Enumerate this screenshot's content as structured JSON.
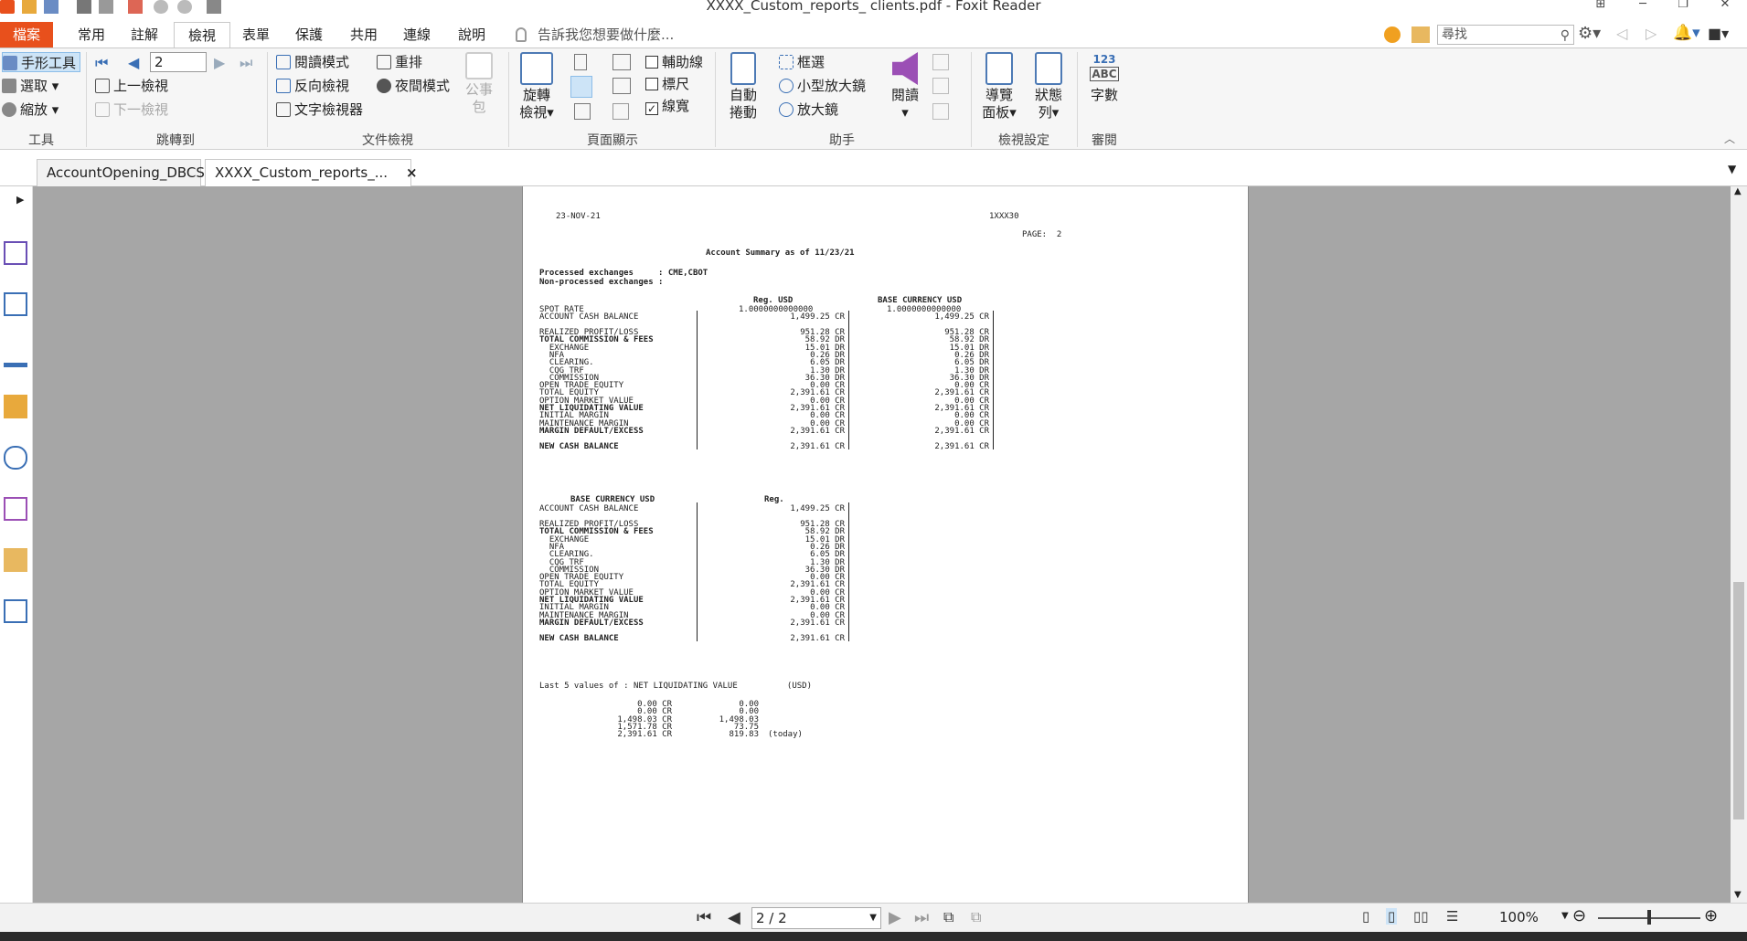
{
  "window": {
    "title": "XXXX_Custom_reports_ clients.pdf - Foxit Reader"
  },
  "tabs": [
    {
      "label": "檔案"
    },
    {
      "label": "常用"
    },
    {
      "label": "註解"
    },
    {
      "label": "檢視"
    },
    {
      "label": "表單"
    },
    {
      "label": "保護"
    },
    {
      "label": "共用"
    },
    {
      "label": "連線"
    },
    {
      "label": "說明"
    }
  ],
  "tell_me": "告訴我您想要做什麼...",
  "search": {
    "placeholder": "尋找"
  },
  "ribbon": {
    "tools": {
      "hand": "手形工具",
      "select": "選取",
      "zoom": "縮放",
      "label": "工具"
    },
    "goto": {
      "page": "2",
      "prev_view": "上一檢視",
      "next_view": "下一檢視",
      "label": "跳轉到"
    },
    "docview": {
      "read_mode": "閱讀模式",
      "reverse_view": "反向檢視",
      "text_viewer": "文字檢視器",
      "reflow": "重排",
      "night_mode": "夜間模式",
      "bulletin": "公事包",
      "label": "文件檢視"
    },
    "pagedisplay": {
      "rotate": "旋轉",
      "rotate2": "檢視",
      "guides": "輔助線",
      "ruler": "標尺",
      "linewidth": "線寬",
      "label": "頁面顯示"
    },
    "assistant": {
      "auto_scroll": "自動",
      "auto_scroll2": "捲動",
      "marquee": "框選",
      "loupe": "小型放大鏡",
      "magnifier": "放大鏡",
      "label": "助手"
    },
    "read": {
      "read": "閱讀"
    },
    "viewsettings": {
      "nav_panel": "導覽",
      "nav_panel2": "面板",
      "status_bar": "狀態",
      "status_bar2": "列",
      "label": "檢視設定"
    },
    "review": {
      "word_count": "字數",
      "icon_text_top": "123",
      "icon_text_bottom": "ABC",
      "label": "審閱"
    }
  },
  "doc_tabs": [
    {
      "label": "AccountOpening_DBCS..."
    },
    {
      "label": "XXXX_Custom_reports_...",
      "close": "×"
    }
  ],
  "pdf": {
    "date": "23-NOV-21",
    "acct": "1XXX30",
    "page_no": "PAGE:  2",
    "title": "Account Summary as of 11/23/21",
    "processed": "Processed exchanges     : CME,CBOT",
    "nonprocessed": "Non-processed exchanges :",
    "col1": "Reg. USD",
    "col2": "BASE CURRENCY USD",
    "spot_label": "SPOT RATE",
    "spot1": "1.0000000000000",
    "spot2": "1.0000000000000",
    "rows": [
      {
        "label": "ACCOUNT CASH BALANCE",
        "v1": "1,499.25 CR",
        "v2": "1,499.25 CR",
        "bold": false,
        "gap": false
      },
      {
        "label": "REALIZED PROFIT/LOSS",
        "v1": "951.28 CR",
        "v2": "951.28 CR",
        "bold": false,
        "gap": true
      },
      {
        "label": "TOTAL COMMISSION & FEES",
        "v1": "58.92 DR",
        "v2": "58.92 DR",
        "bold": true,
        "gap": false
      },
      {
        "label": "  EXCHANGE",
        "v1": "15.01 DR",
        "v2": "15.01 DR",
        "bold": false,
        "gap": false
      },
      {
        "label": "  NFA",
        "v1": "0.26 DR",
        "v2": "0.26 DR",
        "bold": false,
        "gap": false
      },
      {
        "label": "  CLEARING.",
        "v1": "6.05 DR",
        "v2": "6.05 DR",
        "bold": false,
        "gap": false
      },
      {
        "label": "  CQG TRF",
        "v1": "1.30 DR",
        "v2": "1.30 DR",
        "bold": false,
        "gap": false
      },
      {
        "label": "  COMMISSION",
        "v1": "36.30 DR",
        "v2": "36.30 DR",
        "bold": false,
        "gap": false
      },
      {
        "label": "OPEN TRADE EQUITY",
        "v1": "0.00 CR",
        "v2": "0.00 CR",
        "bold": false,
        "gap": false
      },
      {
        "label": "TOTAL EQUITY",
        "v1": "2,391.61 CR",
        "v2": "2,391.61 CR",
        "bold": false,
        "gap": false
      },
      {
        "label": "OPTION MARKET VALUE",
        "v1": "0.00 CR",
        "v2": "0.00 CR",
        "bold": false,
        "gap": false
      },
      {
        "label": "NET LIQUIDATING VALUE",
        "v1": "2,391.61 CR",
        "v2": "2,391.61 CR",
        "bold": true,
        "gap": false
      },
      {
        "label": "INITIAL MARGIN",
        "v1": "0.00 CR",
        "v2": "0.00 CR",
        "bold": false,
        "gap": false
      },
      {
        "label": "MAINTENANCE MARGIN",
        "v1": "0.00 CR",
        "v2": "0.00 CR",
        "bold": false,
        "gap": false
      },
      {
        "label": "MARGIN DEFAULT/EXCESS",
        "v1": "2,391.61 CR",
        "v2": "2,391.61 CR",
        "bold": true,
        "gap": false
      },
      {
        "label": "NEW CASH BALANCE",
        "v1": "2,391.61 CR",
        "v2": "2,391.61 CR",
        "bold": true,
        "gap": true
      }
    ],
    "sec2_head": "BASE CURRENCY USD",
    "sec2_col": "Reg.",
    "rows2": [
      {
        "label": "ACCOUNT CASH BALANCE",
        "v1": "1,499.25 CR",
        "bold": false,
        "gap": false
      },
      {
        "label": "REALIZED PROFIT/LOSS",
        "v1": "951.28 CR",
        "bold": false,
        "gap": true
      },
      {
        "label": "TOTAL COMMISSION & FEES",
        "v1": "58.92 DR",
        "bold": true,
        "gap": false
      },
      {
        "label": "  EXCHANGE",
        "v1": "15.01 DR",
        "bold": false,
        "gap": false
      },
      {
        "label": "  NFA",
        "v1": "0.26 DR",
        "bold": false,
        "gap": false
      },
      {
        "label": "  CLEARING.",
        "v1": "6.05 DR",
        "bold": false,
        "gap": false
      },
      {
        "label": "  CQG TRF",
        "v1": "1.30 DR",
        "bold": false,
        "gap": false
      },
      {
        "label": "  COMMISSION",
        "v1": "36.30 DR",
        "bold": false,
        "gap": false
      },
      {
        "label": "OPEN TRADE EQUITY",
        "v1": "0.00 CR",
        "bold": false,
        "gap": false
      },
      {
        "label": "TOTAL EQUITY",
        "v1": "2,391.61 CR",
        "bold": false,
        "gap": false
      },
      {
        "label": "OPTION MARKET VALUE",
        "v1": "0.00 CR",
        "bold": false,
        "gap": false
      },
      {
        "label": "NET LIQUIDATING VALUE",
        "v1": "2,391.61 CR",
        "bold": true,
        "gap": false
      },
      {
        "label": "INITIAL MARGIN",
        "v1": "0.00 CR",
        "bold": false,
        "gap": false
      },
      {
        "label": "MAINTENANCE MARGIN",
        "v1": "0.00 CR",
        "bold": false,
        "gap": false
      },
      {
        "label": "MARGIN DEFAULT/EXCESS",
        "v1": "2,391.61 CR",
        "bold": true,
        "gap": false
      },
      {
        "label": "NEW CASH BALANCE",
        "v1": "2,391.61 CR",
        "bold": true,
        "gap": true
      }
    ],
    "last5_title": "Last 5 values of : NET LIQUIDATING VALUE          (USD)",
    "last5": [
      {
        "a": "0.00 CR",
        "b": "0.00",
        "note": ""
      },
      {
        "a": "0.00 CR",
        "b": "0.00",
        "note": ""
      },
      {
        "a": "1,498.03 CR",
        "b": "1,498.03",
        "note": ""
      },
      {
        "a": "1,571.78 CR",
        "b": "73.75",
        "note": ""
      },
      {
        "a": "2,391.61 CR",
        "b": "819.83",
        "note": "(today)"
      }
    ]
  },
  "statusbar": {
    "page": "2 / 2",
    "zoom": "100%"
  }
}
